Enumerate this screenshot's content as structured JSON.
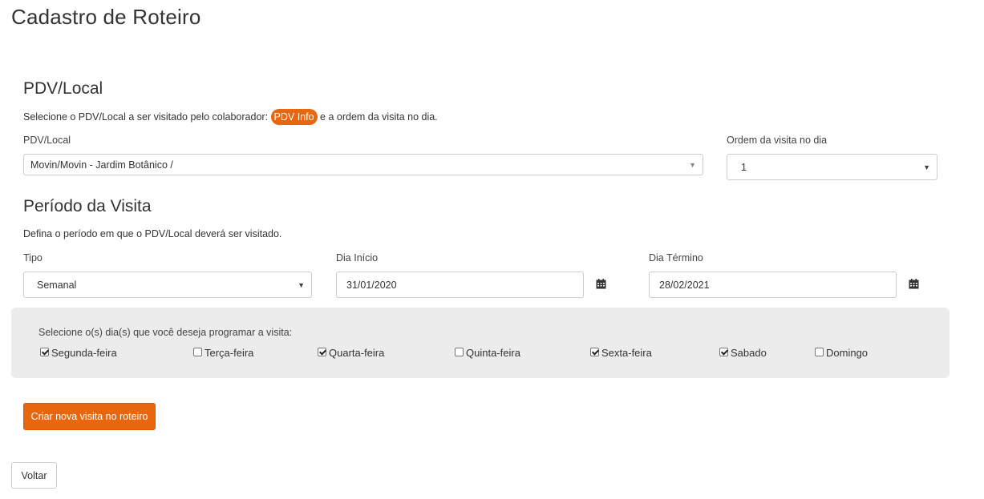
{
  "page": {
    "title": "Cadastro de Roteiro"
  },
  "pdv_section": {
    "title": "PDV/Local",
    "desc_before": "Selecione o PDV/Local a ser visitado pelo colaborador:",
    "pill": "PDV Info",
    "desc_after": "e a ordem da visita no dia.",
    "pdv_label": "PDV/Local",
    "pdv_value": "Movin/Movin - Jardim Botânico /",
    "order_label": "Ordem da visita no dia",
    "order_value": "1"
  },
  "period_section": {
    "title": "Período da Visita",
    "desc": "Defina o período em que o PDV/Local deverá ser visitado.",
    "type_label": "Tipo",
    "type_value": "Semanal",
    "start_label": "Dia Início",
    "start_value": "31/01/2020",
    "end_label": "Dia Término",
    "end_value": "28/02/2021"
  },
  "days": {
    "prompt": "Selecione o(s) dia(s) que você deseja programar a visita:",
    "items": [
      {
        "label": "Segunda-feira",
        "checked": true
      },
      {
        "label": "Terça-feira",
        "checked": false
      },
      {
        "label": "Quarta-feira",
        "checked": true
      },
      {
        "label": "Quinta-feira",
        "checked": false
      },
      {
        "label": "Sexta-feira",
        "checked": true
      },
      {
        "label": "Sabado",
        "checked": true
      },
      {
        "label": "Domingo",
        "checked": false
      }
    ]
  },
  "actions": {
    "create_label": "Criar nova visita no roteiro",
    "back_label": "Voltar"
  },
  "colors": {
    "accent": "#e8660d",
    "panel": "#ececec"
  },
  "icons": {
    "calendar": "calendar-icon",
    "caret": "caret-down-icon"
  }
}
